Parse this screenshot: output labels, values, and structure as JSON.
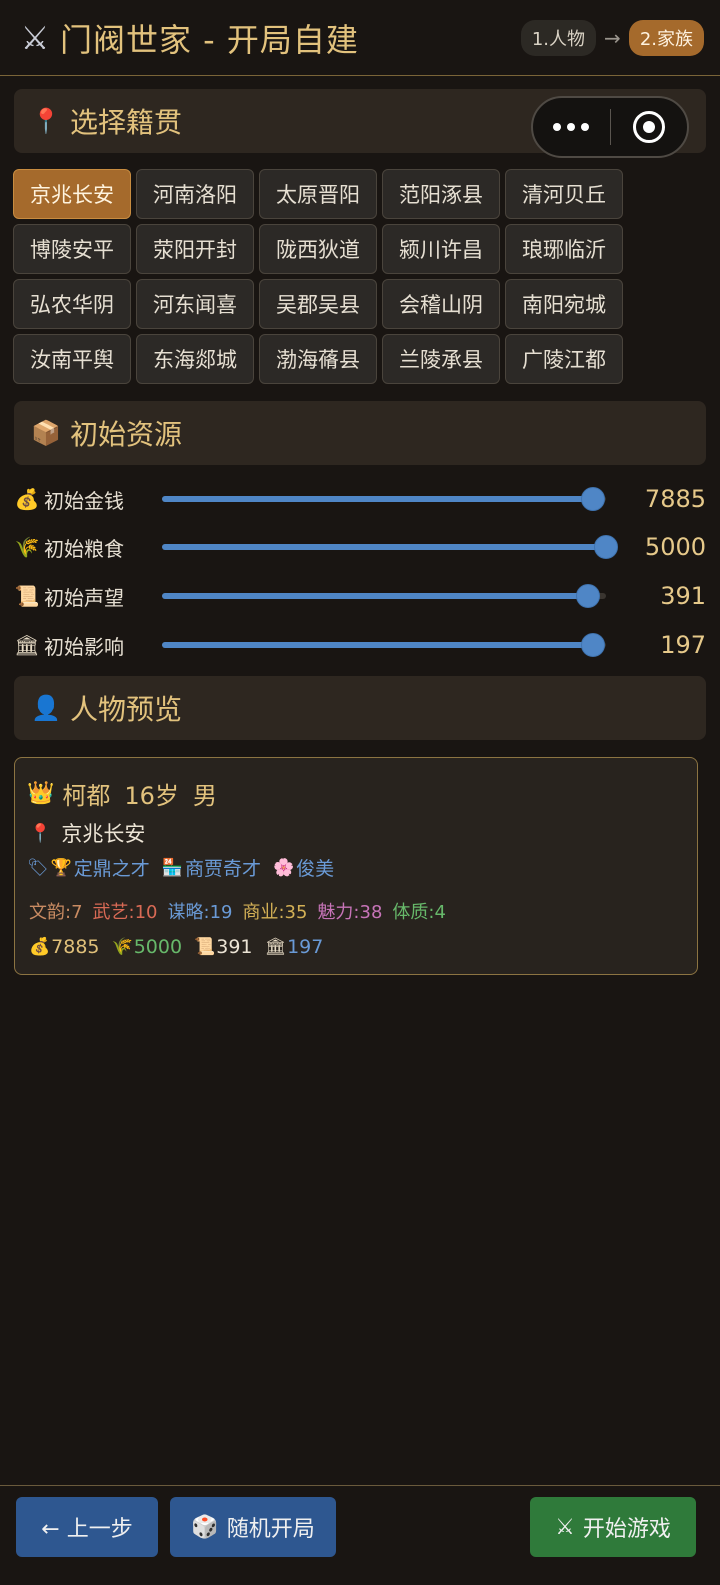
{
  "header": {
    "app_icon": "crossed-swords-icon",
    "title": "门阀世家 - 开局自建",
    "steps": [
      {
        "label": "1.人物",
        "active": false
      },
      {
        "label": "2.家族",
        "active": true
      }
    ],
    "step_arrow": "→"
  },
  "origin_section": {
    "icon": "pin-icon",
    "title": "选择籍贯",
    "selected": "京兆长安",
    "options": [
      "京兆长安",
      "河南洛阳",
      "太原晋阳",
      "范阳涿县",
      "清河贝丘",
      "博陵安平",
      "荥阳开封",
      "陇西狄道",
      "颍川许昌",
      "琅琊临沂",
      "弘农华阴",
      "河东闻喜",
      "吴郡吴县",
      "会稽山阴",
      "南阳宛城",
      "汝南平舆",
      "东海郯城",
      "渤海蓨县",
      "兰陵承县",
      "广陵江都"
    ]
  },
  "resources_section": {
    "icon": "package-icon",
    "title": "初始资源",
    "sliders": [
      {
        "icon": "money-bag-icon",
        "label": "初始金钱",
        "value": "7885",
        "fraction": 0.97
      },
      {
        "icon": "wheat-icon",
        "label": "初始粮食",
        "value": "5000",
        "fraction": 1.0
      },
      {
        "icon": "scroll-icon",
        "label": "初始声望",
        "value": "391",
        "fraction": 0.96
      },
      {
        "icon": "temple-icon",
        "label": "初始影响",
        "value": "197",
        "fraction": 0.97
      }
    ]
  },
  "preview_section": {
    "icon": "person-icon",
    "title": "人物预览",
    "card": {
      "crown_icon": "crown-icon",
      "name": "柯都",
      "age": "16岁",
      "gender": "男",
      "origin_icon": "pin-icon",
      "origin": "京兆长安",
      "tag_icon": "label-tag-icon",
      "traits": [
        {
          "icon": "trophy-icon",
          "label": "定鼎之才"
        },
        {
          "icon": "calendar-shop-icon",
          "label": "商贾奇才"
        },
        {
          "icon": "blossom-icon",
          "label": "俊美"
        }
      ],
      "stats": [
        {
          "label": "文韵:7",
          "color": "#c98b62"
        },
        {
          "label": "武艺:10",
          "color": "#d96a55"
        },
        {
          "label": "谋略:19",
          "color": "#6a9ad6"
        },
        {
          "label": "商业:35",
          "color": "#d3b056"
        },
        {
          "label": "魅力:38",
          "color": "#c774b8"
        },
        {
          "label": "体质:4",
          "color": "#67b86a"
        }
      ],
      "resources": [
        {
          "icon": "money-bag-icon",
          "value": "7885",
          "color": "#e0c07a"
        },
        {
          "icon": "wheat-icon",
          "value": "5000",
          "color": "#67b86a"
        },
        {
          "icon": "scroll-icon",
          "value": "391",
          "color": "#ece4d5"
        },
        {
          "icon": "temple-icon",
          "value": "197",
          "color": "#6a9ad6"
        }
      ]
    }
  },
  "footer": {
    "back_label": "← 上一步",
    "random_label": "随机开局",
    "random_icon": "dice-icon",
    "start_label": "开始游戏",
    "start_icon": "crossed-swords-icon"
  },
  "colors": {
    "background": "#191512",
    "accent_gold": "#e2c27d",
    "selected_orange": "#a56a2c",
    "slider_blue": "#4f86c6",
    "button_blue": "#2e5790",
    "button_green": "#2f7a3a"
  }
}
